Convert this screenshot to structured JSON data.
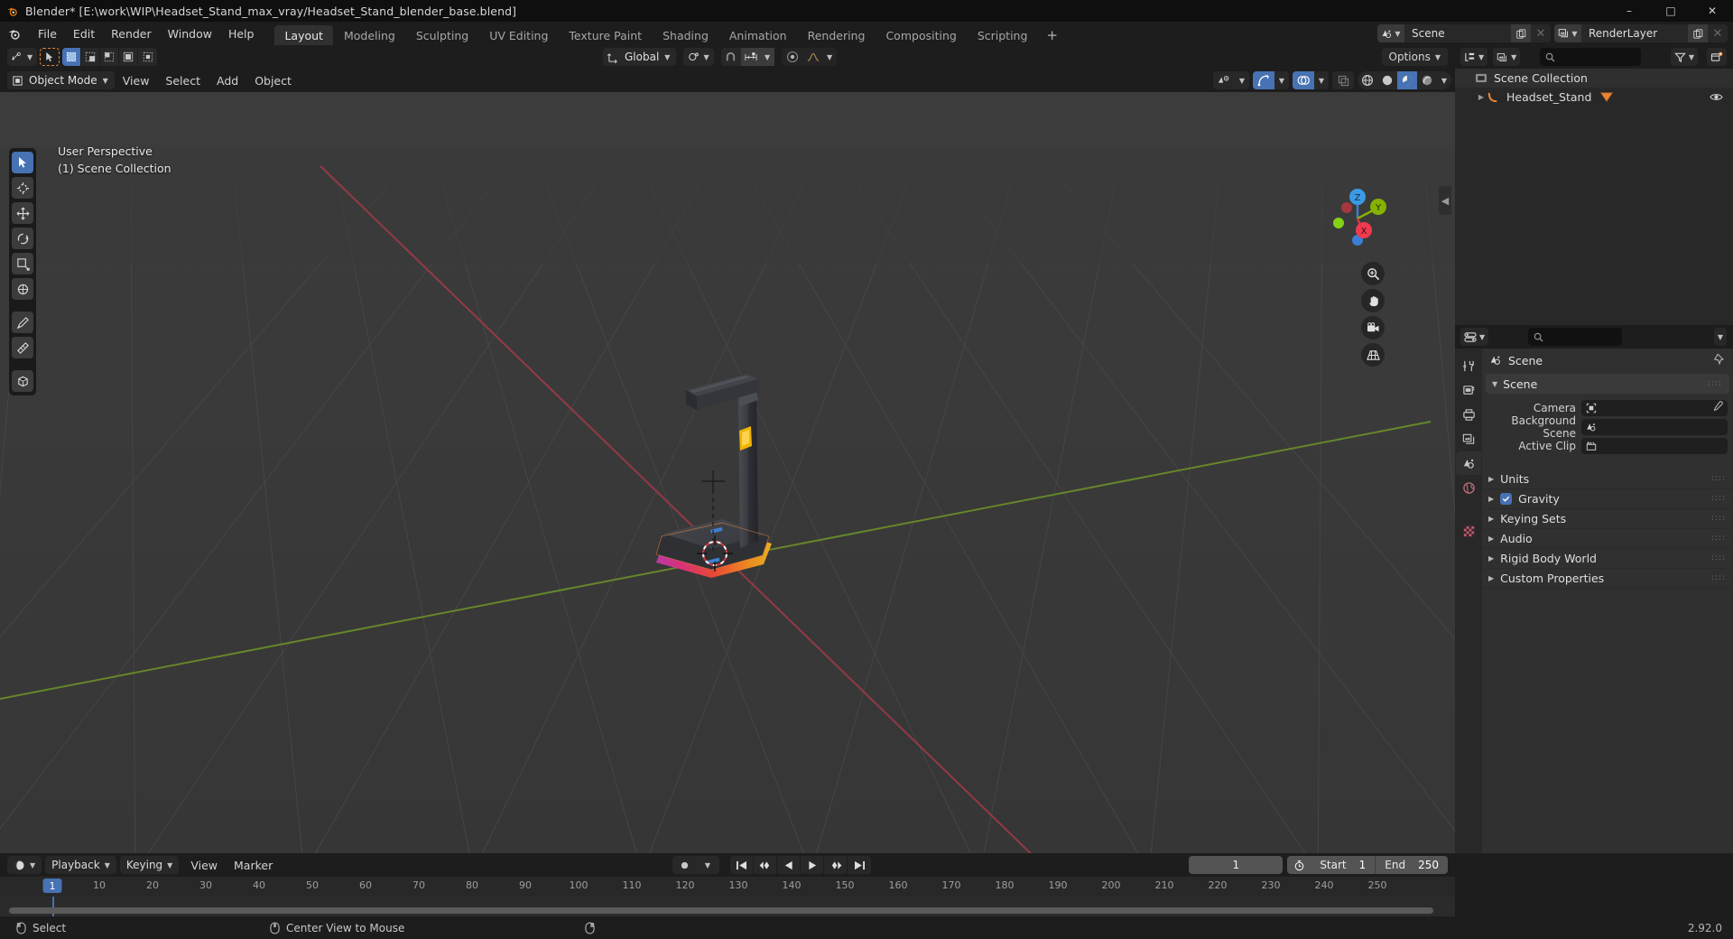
{
  "window": {
    "title": "Blender* [E:\\work\\WIP\\Headset_Stand_max_vray/Headset_Stand_blender_base.blend]",
    "minimize": "–",
    "maximize": "□",
    "close": "✕"
  },
  "menubar": {
    "items": [
      "File",
      "Edit",
      "Render",
      "Window",
      "Help"
    ]
  },
  "workspace_tabs": [
    {
      "label": "Layout",
      "active": true
    },
    {
      "label": "Modeling",
      "active": false
    },
    {
      "label": "Sculpting",
      "active": false
    },
    {
      "label": "UV Editing",
      "active": false
    },
    {
      "label": "Texture Paint",
      "active": false
    },
    {
      "label": "Shading",
      "active": false
    },
    {
      "label": "Animation",
      "active": false
    },
    {
      "label": "Rendering",
      "active": false
    },
    {
      "label": "Compositing",
      "active": false
    },
    {
      "label": "Scripting",
      "active": false
    }
  ],
  "workspace_add": "+",
  "topbar_right": {
    "scene_name": "Scene",
    "viewlayer_name": "RenderLayer"
  },
  "tool_header": {
    "options_label": "Options"
  },
  "viewport_header": {
    "mode": "Object Mode",
    "menus": [
      "View",
      "Select",
      "Add",
      "Object"
    ],
    "transform_orientation": "Global"
  },
  "viewport": {
    "perspective": "User Perspective",
    "collection": "(1) Scene Collection",
    "gizmo_axes": [
      {
        "label": "Z",
        "color": "#3b7fd4"
      },
      {
        "label": "Y",
        "color": "#86b200"
      },
      {
        "label": "X",
        "color": "#d6374a"
      }
    ],
    "object_name": "Headset_Stand"
  },
  "outliner": {
    "search_placeholder": "",
    "rows": [
      {
        "label": "Scene Collection",
        "depth": 0,
        "icon": "collection-icon"
      },
      {
        "label": "Headset_Stand",
        "depth": 1,
        "icon": "object-icon"
      }
    ]
  },
  "properties": {
    "breadcrumb": "Scene",
    "panel_title": "Scene",
    "fields": [
      {
        "label": "Camera",
        "value": "",
        "icon": "camera-icon"
      },
      {
        "label": "Background Scene",
        "value": "",
        "icon": "scene-icon"
      },
      {
        "label": "Active Clip",
        "value": "",
        "icon": "clip-icon"
      }
    ],
    "sections": [
      {
        "label": "Units",
        "checkbox": false
      },
      {
        "label": "Gravity",
        "checkbox": true
      },
      {
        "label": "Keying Sets",
        "checkbox": false
      },
      {
        "label": "Audio",
        "checkbox": false
      },
      {
        "label": "Rigid Body World",
        "checkbox": false
      },
      {
        "label": "Custom Properties",
        "checkbox": false
      }
    ]
  },
  "timeline": {
    "menus": [
      "View",
      "Marker"
    ],
    "dropdowns": [
      "Playback",
      "Keying"
    ],
    "ticks": [
      10,
      20,
      30,
      40,
      50,
      60,
      70,
      80,
      90,
      100,
      110,
      120,
      130,
      140,
      150,
      160,
      170,
      180,
      190,
      200,
      210,
      220,
      230,
      240,
      250
    ],
    "current_frame": "1",
    "start_label": "Start",
    "start_value": "1",
    "end_label": "End",
    "end_value": "250"
  },
  "statusbar": {
    "left_action": "Select",
    "mid_action": "Center View to Mouse",
    "version": "2.92.0"
  },
  "colors": {
    "accent_blue": "#4772b3",
    "orange": "#e8863a",
    "axis_x": "#d6374a",
    "axis_y": "#86b200",
    "axis_z": "#3b7fd4",
    "bg_viewport": "#393939",
    "bg_panel": "#303030",
    "bg_header": "#1d1d1d"
  }
}
